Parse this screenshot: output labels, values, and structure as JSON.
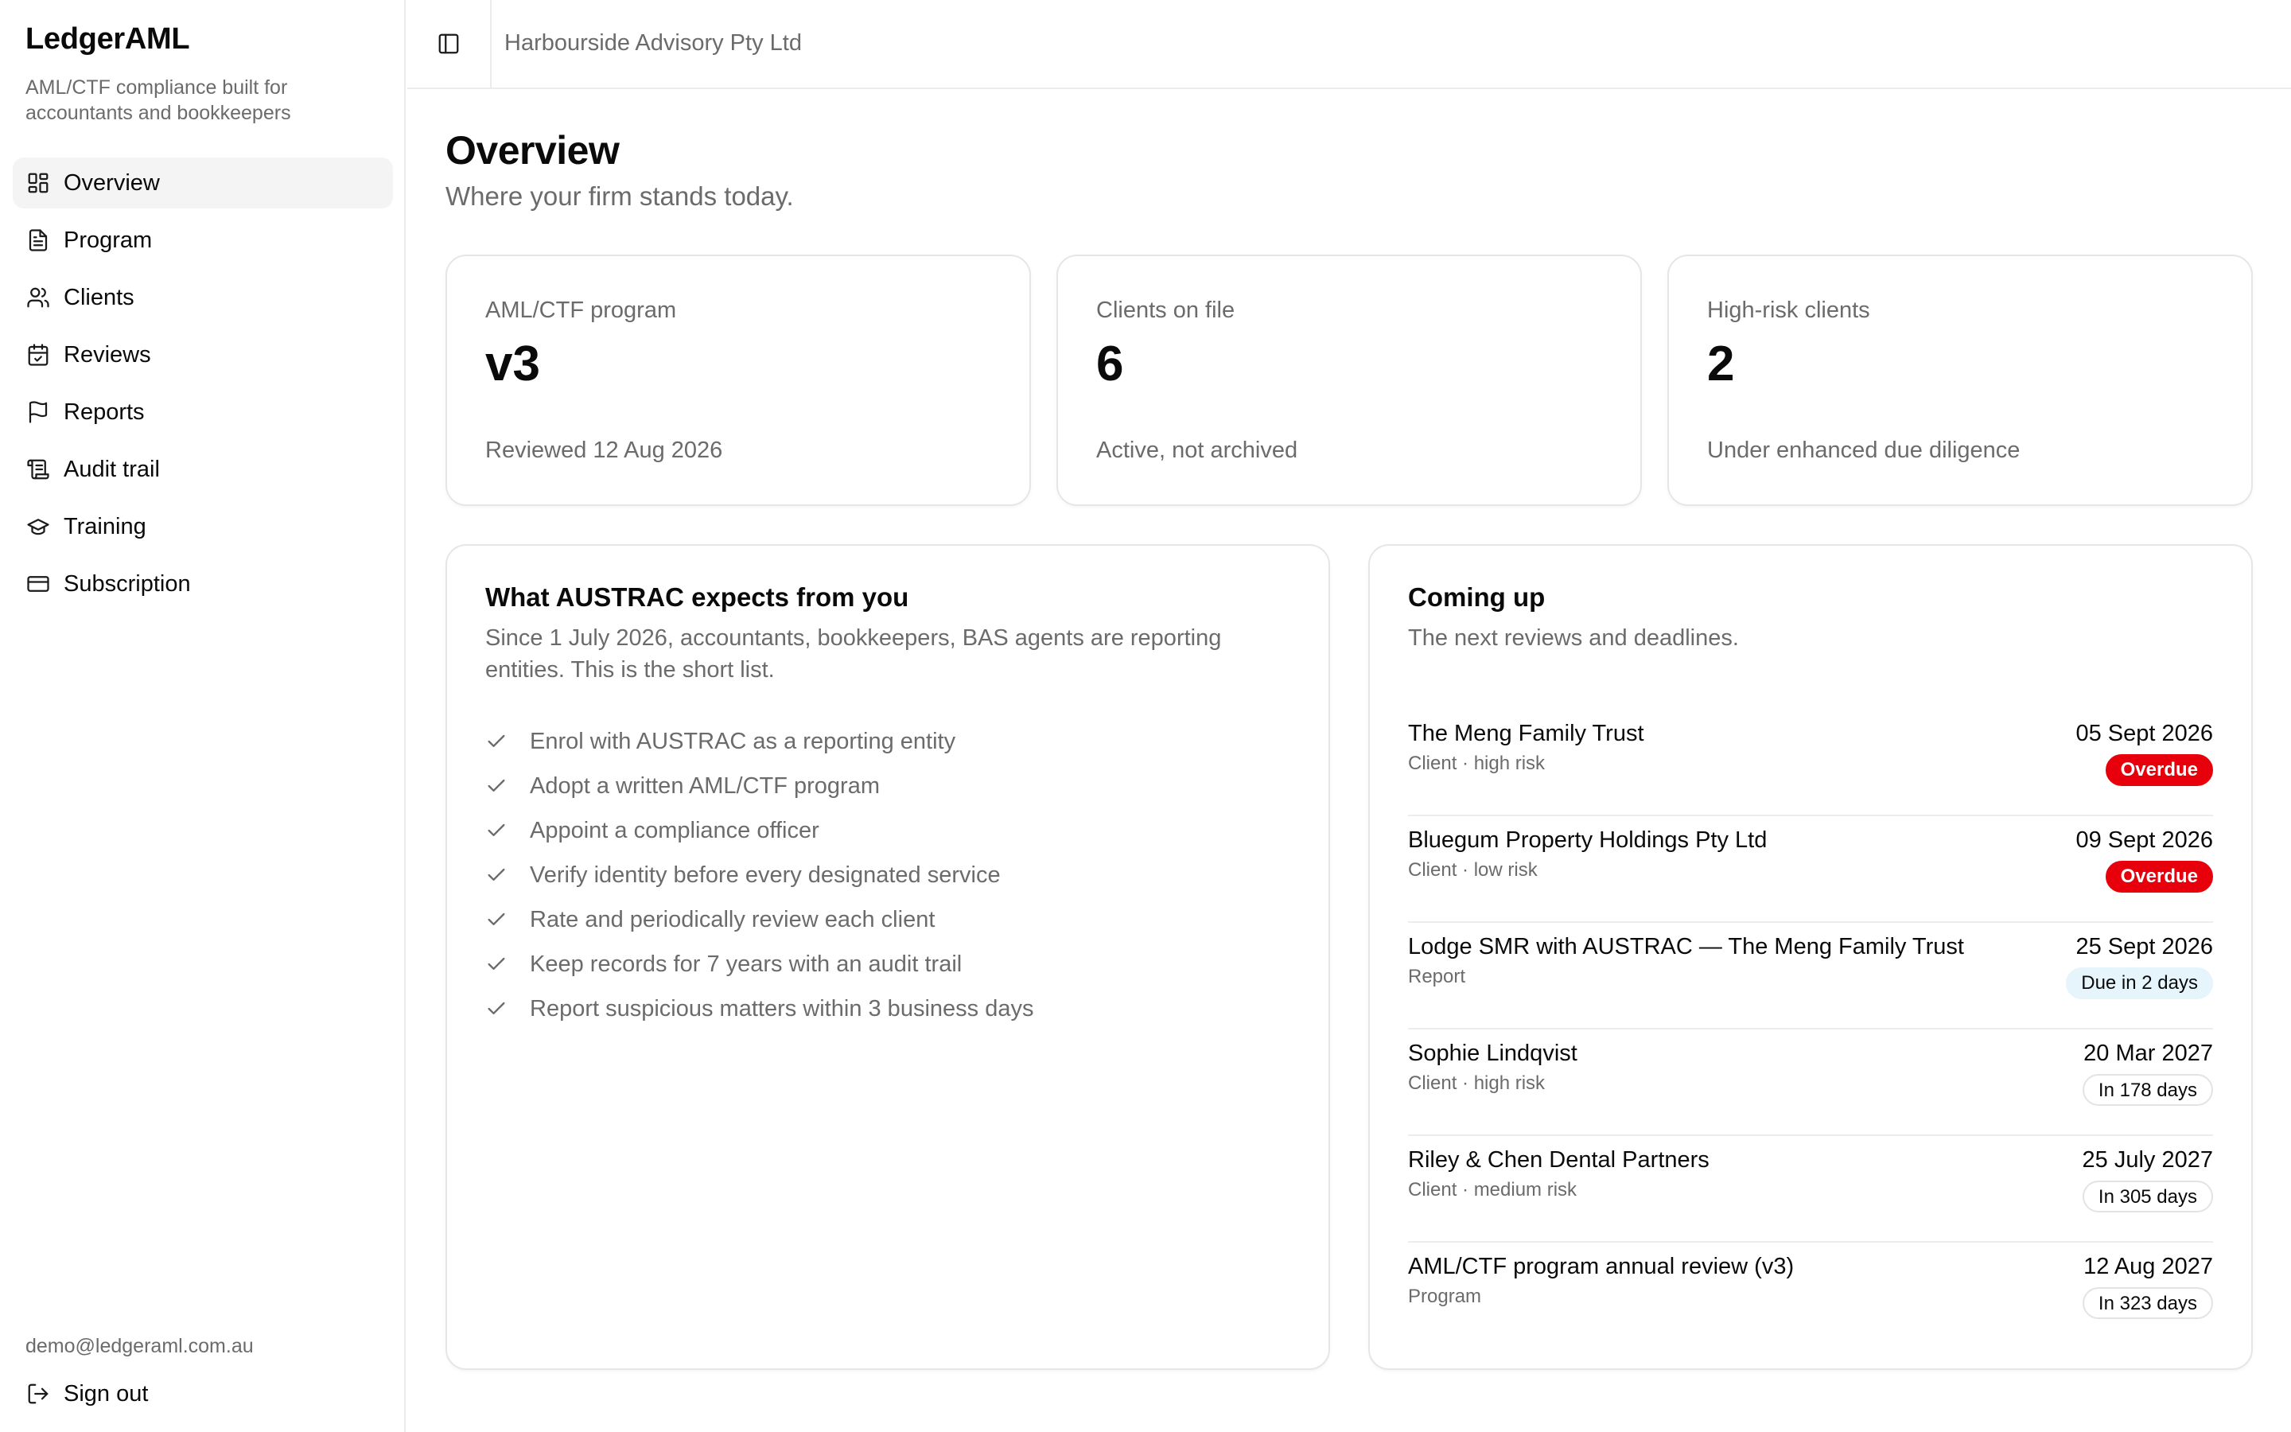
{
  "app": {
    "name": "LedgerAML",
    "tagline": "AML/CTF compliance built for accountants and bookkeepers"
  },
  "nav": {
    "items": [
      {
        "label": "Overview",
        "icon": "dashboard-icon"
      },
      {
        "label": "Program",
        "icon": "document-icon"
      },
      {
        "label": "Clients",
        "icon": "users-icon"
      },
      {
        "label": "Reviews",
        "icon": "calendar-check-icon"
      },
      {
        "label": "Reports",
        "icon": "flag-icon"
      },
      {
        "label": "Audit trail",
        "icon": "scroll-icon"
      },
      {
        "label": "Training",
        "icon": "graduation-cap-icon"
      },
      {
        "label": "Subscription",
        "icon": "credit-card-icon"
      }
    ],
    "active": "Overview"
  },
  "user": {
    "email": "demo@ledgeraml.com.au",
    "sign_out_label": "Sign out"
  },
  "topbar": {
    "org_name": "Harbourside Advisory Pty Ltd"
  },
  "page": {
    "title": "Overview",
    "subtitle": "Where your firm stands today."
  },
  "stats": [
    {
      "label": "AML/CTF program",
      "value": "v3",
      "note": "Reviewed 12 Aug 2026"
    },
    {
      "label": "Clients on file",
      "value": "6",
      "note": "Active, not archived"
    },
    {
      "label": "High-risk clients",
      "value": "2",
      "note": "Under enhanced due diligence"
    }
  ],
  "expectations": {
    "title": "What AUSTRAC expects from you",
    "description": "Since 1 July 2026, accountants, bookkeepers, BAS agents are reporting entities. This is the short list.",
    "items": [
      "Enrol with AUSTRAC as a reporting entity",
      "Adopt a written AML/CTF program",
      "Appoint a compliance officer",
      "Verify identity before every designated service",
      "Rate and periodically review each client",
      "Keep records for 7 years with an audit trail",
      "Report suspicious matters within 3 business days"
    ]
  },
  "coming_up": {
    "title": "Coming up",
    "description": "The next reviews and deadlines.",
    "items": [
      {
        "title": "The Meng Family Trust",
        "meta": "Client · high risk",
        "date": "05 Sept 2026",
        "badge": "Overdue",
        "status": "overdue"
      },
      {
        "title": "Bluegum Property Holdings Pty Ltd",
        "meta": "Client · low risk",
        "date": "09 Sept 2026",
        "badge": "Overdue",
        "status": "overdue"
      },
      {
        "title": "Lodge SMR with AUSTRAC — The Meng Family Trust",
        "meta": "Report",
        "date": "25 Sept 2026",
        "badge": "Due in 2 days",
        "status": "soon"
      },
      {
        "title": "Sophie Lindqvist",
        "meta": "Client · high risk",
        "date": "20 Mar 2027",
        "badge": "In 178 days",
        "status": "later"
      },
      {
        "title": "Riley & Chen Dental Partners",
        "meta": "Client · medium risk",
        "date": "25 July 2027",
        "badge": "In 305 days",
        "status": "later"
      },
      {
        "title": "AML/CTF program annual review (v3)",
        "meta": "Program",
        "date": "12 Aug 2027",
        "badge": "In 323 days",
        "status": "later"
      }
    ]
  },
  "colors": {
    "overdue": "#e7000b",
    "soon_bg": "#e6f4fc",
    "muted_text": "#6b6b6b",
    "border": "#e6e6e6"
  }
}
